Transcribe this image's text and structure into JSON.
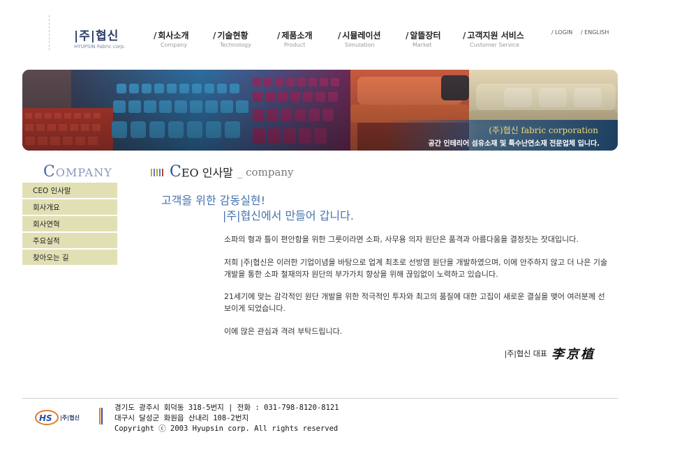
{
  "header": {
    "logo_kr": "|주|협신",
    "logo_en": "HYUPSIN Fabric corp.",
    "nav": [
      {
        "kr": "회사소개",
        "en": "Company"
      },
      {
        "kr": "기술현황",
        "en": "Technology"
      },
      {
        "kr": "제품소개",
        "en": "Product"
      },
      {
        "kr": "시뮬레이션",
        "en": "Simulation"
      },
      {
        "kr": "알뜰장터",
        "en": "Market"
      },
      {
        "kr": "고객지원 서비스",
        "en": "Customer Service"
      }
    ],
    "login": "LOGIN",
    "english": "ENGLISH"
  },
  "banner": {
    "caption1": "(주)협신 fabric corporation",
    "caption2": "공간 인테리어 섬유소재 및 특수난연소재 전문업체 입니다."
  },
  "sidebar": {
    "title_cap": "C",
    "title_rest": "OMPANY",
    "items": [
      {
        "label": "CEO 인사말"
      },
      {
        "label": "회사개요"
      },
      {
        "label": "회사연혁"
      },
      {
        "label": "주요실적"
      },
      {
        "label": "찾아오는 길"
      }
    ]
  },
  "content": {
    "title_cap": "C",
    "title_rest": "EO 인사말",
    "title_sub": "_ company",
    "headline1": "고객을 위한 감동실현!",
    "headline2": "|주|협신에서 만들어 갑니다.",
    "paragraphs": [
      "소파의 형과 틀이 편안함을 위한 그릇이라면 소파, 사무용 의자 원단은 품격과 아름다움을 결정짓는 잣대입니다.",
      "저희 |주|협신은 이러한 기업이념을 바탕으로 업계 최초로 선방염 원단을 개발하였으며, 이에 안주하지 않고 더 나은 기술 개발을 통한 소파 철재의자 원단의 부가가치 향상을 위해 끊임없이 노력하고 있습니다.",
      "21세기에 맞는 감각적인 원단 개발을 위한 적극적인 투자와 최고의 품질에 대한 고집이 새로운 결실을 맺어 여러분께 선보이게 되었습니다.",
      "이에 많은 관심과 격려 부탁드립니다."
    ],
    "signature_role": "|주|협신 대표",
    "signature_name": "李京植"
  },
  "footer": {
    "logo_mark": "HS",
    "logo_text": "|주|협신",
    "line1": "경기도 광주시 회덕동 318-5번지 | 전화 : 031-798-8120-8121",
    "line2": "대구시 달성군 화원읍 산내리 108-2번지",
    "line3": "Copyright ⓒ 2003 Hyupsin corp. All rights reserved"
  },
  "colors": {
    "sidebar_bg": "#e1e0b5",
    "headline": "#4673b0",
    "accent_blue": "#2f4f94"
  }
}
